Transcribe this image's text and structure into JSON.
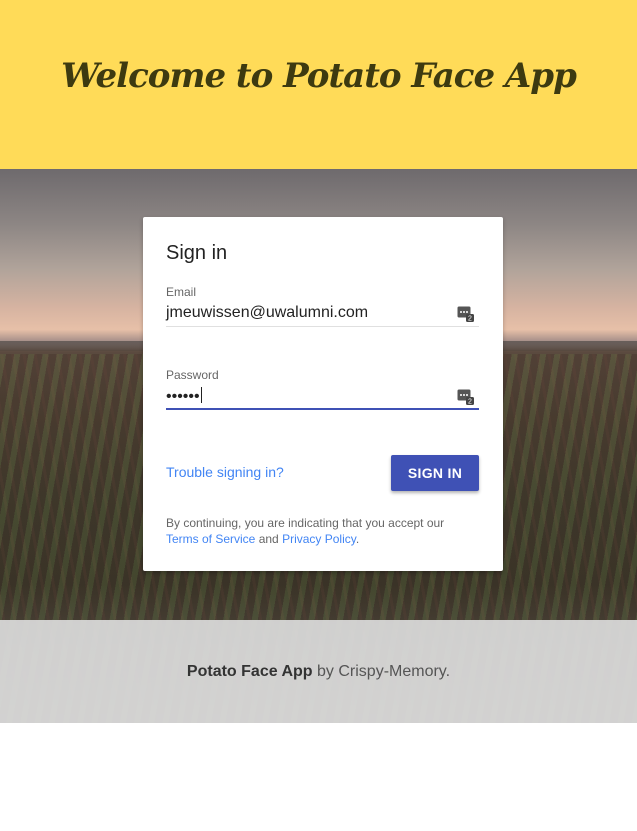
{
  "header": {
    "title": "Welcome to Potato Face App"
  },
  "signin": {
    "title": "Sign in",
    "email_label": "Email",
    "email_value": "jmeuwissen@uwalumni.com",
    "password_label": "Password",
    "password_value": "••••••",
    "trouble_link": "Trouble signing in?",
    "submit_label": "SIGN IN",
    "legal_prefix": "By continuing, you are indicating that you accept our",
    "terms_link": "Terms of Service",
    "legal_and": "and",
    "privacy_link": "Privacy Policy",
    "legal_suffix": "."
  },
  "footer": {
    "app_name": "Potato Face App",
    "by_text": "by Crispy-Memory."
  },
  "icons": {
    "field_icon": "password-manager-icon"
  },
  "colors": {
    "header_bg": "#ffdb58",
    "accent": "#3f51b5",
    "link": "#4285f4"
  }
}
